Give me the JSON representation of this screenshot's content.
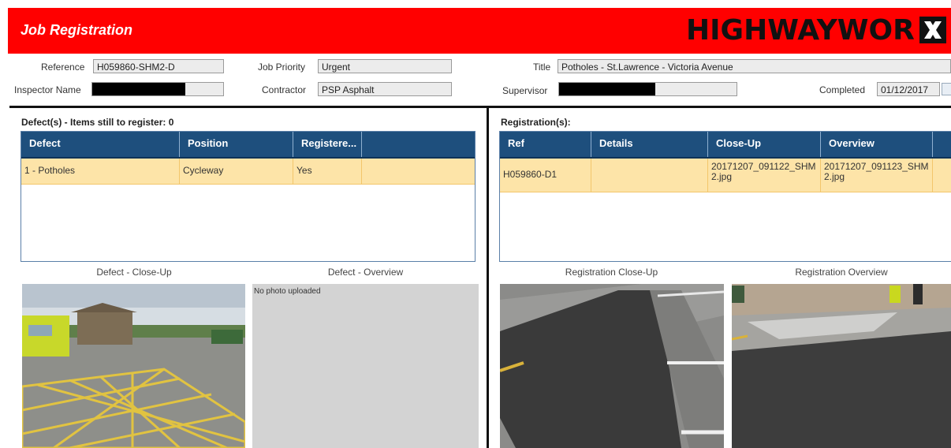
{
  "header": {
    "title": "Job Registration",
    "logo_text": "HIGHWAYWOR",
    "brand_color": "#ff0000"
  },
  "form": {
    "reference_label": "Reference",
    "reference_value": "H059860-SHM2-D",
    "job_priority_label": "Job Priority",
    "job_priority_value": "Urgent",
    "title_label": "Title",
    "title_value": "Potholes - St.Lawrence - Victoria Avenue",
    "inspector_label": "Inspector Name",
    "contractor_label": "Contractor",
    "contractor_value": "PSP Asphalt",
    "supervisor_label": "Supervisor",
    "completed_label": "Completed",
    "completed_value": "01/12/2017",
    "calendar_icon": "calendar-icon"
  },
  "defects": {
    "title": "Defect(s) - Items still to register: 0",
    "columns": [
      "Defect",
      "Position",
      "Registere...",
      ""
    ],
    "rows": [
      [
        "1 - Potholes",
        "Cycleway",
        "Yes",
        ""
      ]
    ],
    "closeup_caption": "Defect - Close-Up",
    "overview_caption": "Defect - Overview",
    "no_photo_text": "No photo uploaded"
  },
  "registrations": {
    "title": "Registration(s):",
    "columns": [
      "Ref",
      "Details",
      "Close-Up",
      "Overview",
      ""
    ],
    "rows": [
      [
        "H059860-D1",
        "",
        "20171207_091122_SHM2.jpg",
        "20171207_091123_SHM2.jpg",
        ""
      ]
    ],
    "closeup_caption": "Registration Close-Up",
    "overview_caption": "Registration Overview"
  }
}
